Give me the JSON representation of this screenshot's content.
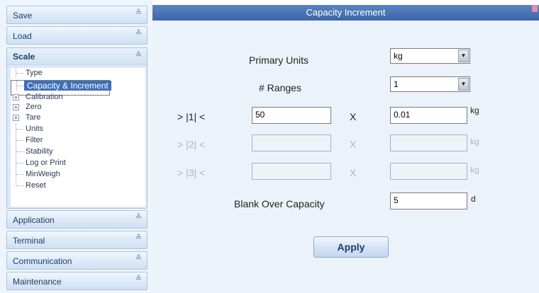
{
  "nav": {
    "save": "Save",
    "load": "Load",
    "scale": "Scale",
    "scale_items": [
      "Type",
      "Capacity & Increment",
      "Calibration",
      "Zero",
      "Tare",
      "Units",
      "Filter",
      "Stability",
      "Log or Print",
      "MinWeigh",
      "Reset"
    ],
    "application": "Application",
    "terminal": "Terminal",
    "communication": "Communication",
    "maintenance": "Maintenance",
    "chevron_down": "≚",
    "chevron_up": "≙"
  },
  "panel": {
    "title": "Capacity  Increment",
    "primary_units_label": "Primary Units",
    "primary_units_value": "kg",
    "ranges_label": "# Ranges",
    "ranges_value": "1",
    "range1_label": "> |1| <",
    "range1_capacity": "50",
    "range1_increment": "0.01",
    "range2_label": "> |2| <",
    "range3_label": "> |3| <",
    "x": "X",
    "unit": "kg",
    "blank_over_label": "Blank Over Capacity",
    "blank_over_value": "5",
    "blank_over_unit": "d",
    "apply": "Apply",
    "dropdown_arrow": "▼"
  }
}
